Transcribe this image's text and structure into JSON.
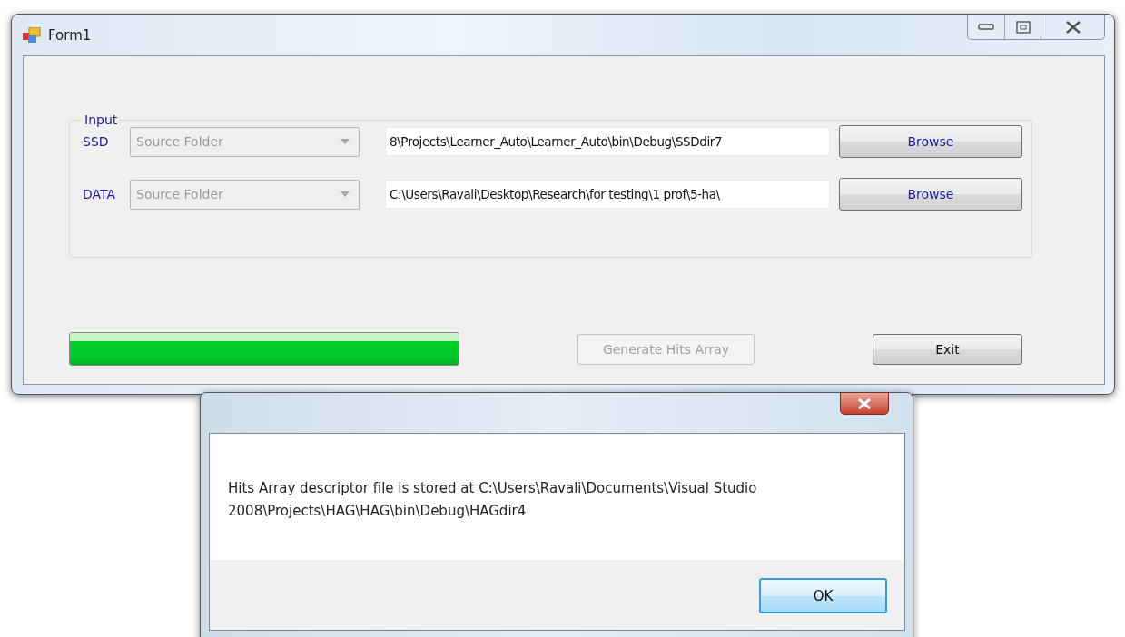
{
  "window": {
    "title": "Form1"
  },
  "input_group": {
    "legend": "Input",
    "rows": [
      {
        "label": "SSD",
        "combo": {
          "value": "Source Folder",
          "disabled": true
        },
        "path": "8\\Projects\\Learner_Auto\\Learner_Auto\\bin\\Debug\\SSDdir7",
        "button": "Browse"
      },
      {
        "label": "DATA",
        "combo": {
          "value": "Source Folder",
          "disabled": true
        },
        "path": "C:\\Users\\Ravali\\Desktop\\Research\\for testing\\1 prof\\5-ha\\",
        "button": "Browse"
      }
    ]
  },
  "progress": {
    "level": 1
  },
  "buttons": [
    {
      "label": "Generate Hits Array",
      "disabled": true
    },
    {
      "label": "Exit",
      "disabled": false
    }
  ],
  "dialog": {
    "message": "Hits Array descriptor file is stored at C:\\Users\\Ravali\\Documents\\Visual Studio 2008\\Projects\\HAG\\HAG\\bin\\Debug\\HAGdir4",
    "button": "OK"
  }
}
